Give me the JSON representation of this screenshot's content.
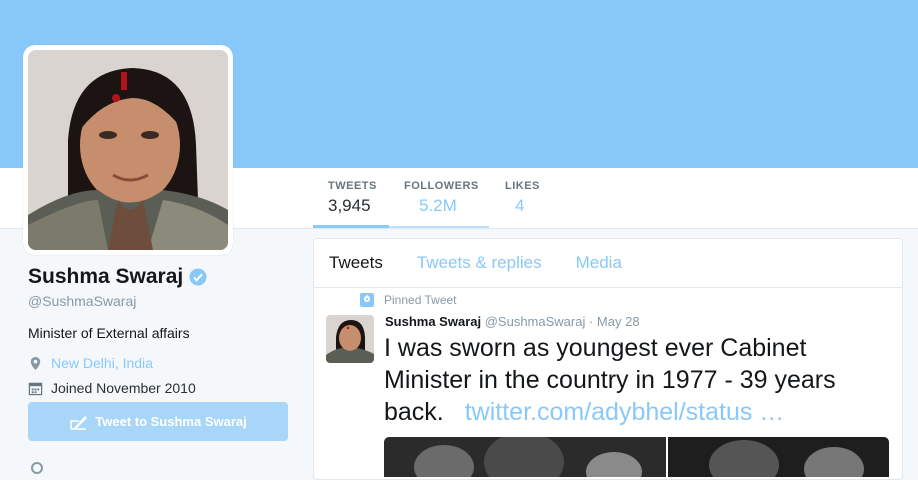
{
  "profile": {
    "name": "Sushma Swaraj",
    "handle": "@SushmaSwaraj",
    "bio": "Minister of External affairs",
    "location": "New Delhi, India",
    "joined": "Joined November 2010",
    "tweet_button": "Tweet to Sushma Swaraj"
  },
  "stats": [
    {
      "label": "TWEETS",
      "value": "3,945"
    },
    {
      "label": "FOLLOWERS",
      "value": "5.2M"
    },
    {
      "label": "LIKES",
      "value": "4"
    }
  ],
  "tabs": [
    "Tweets",
    "Tweets & replies",
    "Media"
  ],
  "tweet": {
    "pinned_label": "Pinned Tweet",
    "author": "Sushma Swaraj",
    "handle": "@SushmaSwaraj",
    "date": "· May 28",
    "text": "I was sworn as youngest ever Cabinet Minister in the country in 1977 - 39 years back.",
    "link": "twitter.com/adybhel/status …"
  },
  "colors": {
    "accent": "#89c9fa",
    "banner": "#89c9fa",
    "text": "#14171a",
    "muted": "#8899a6"
  }
}
